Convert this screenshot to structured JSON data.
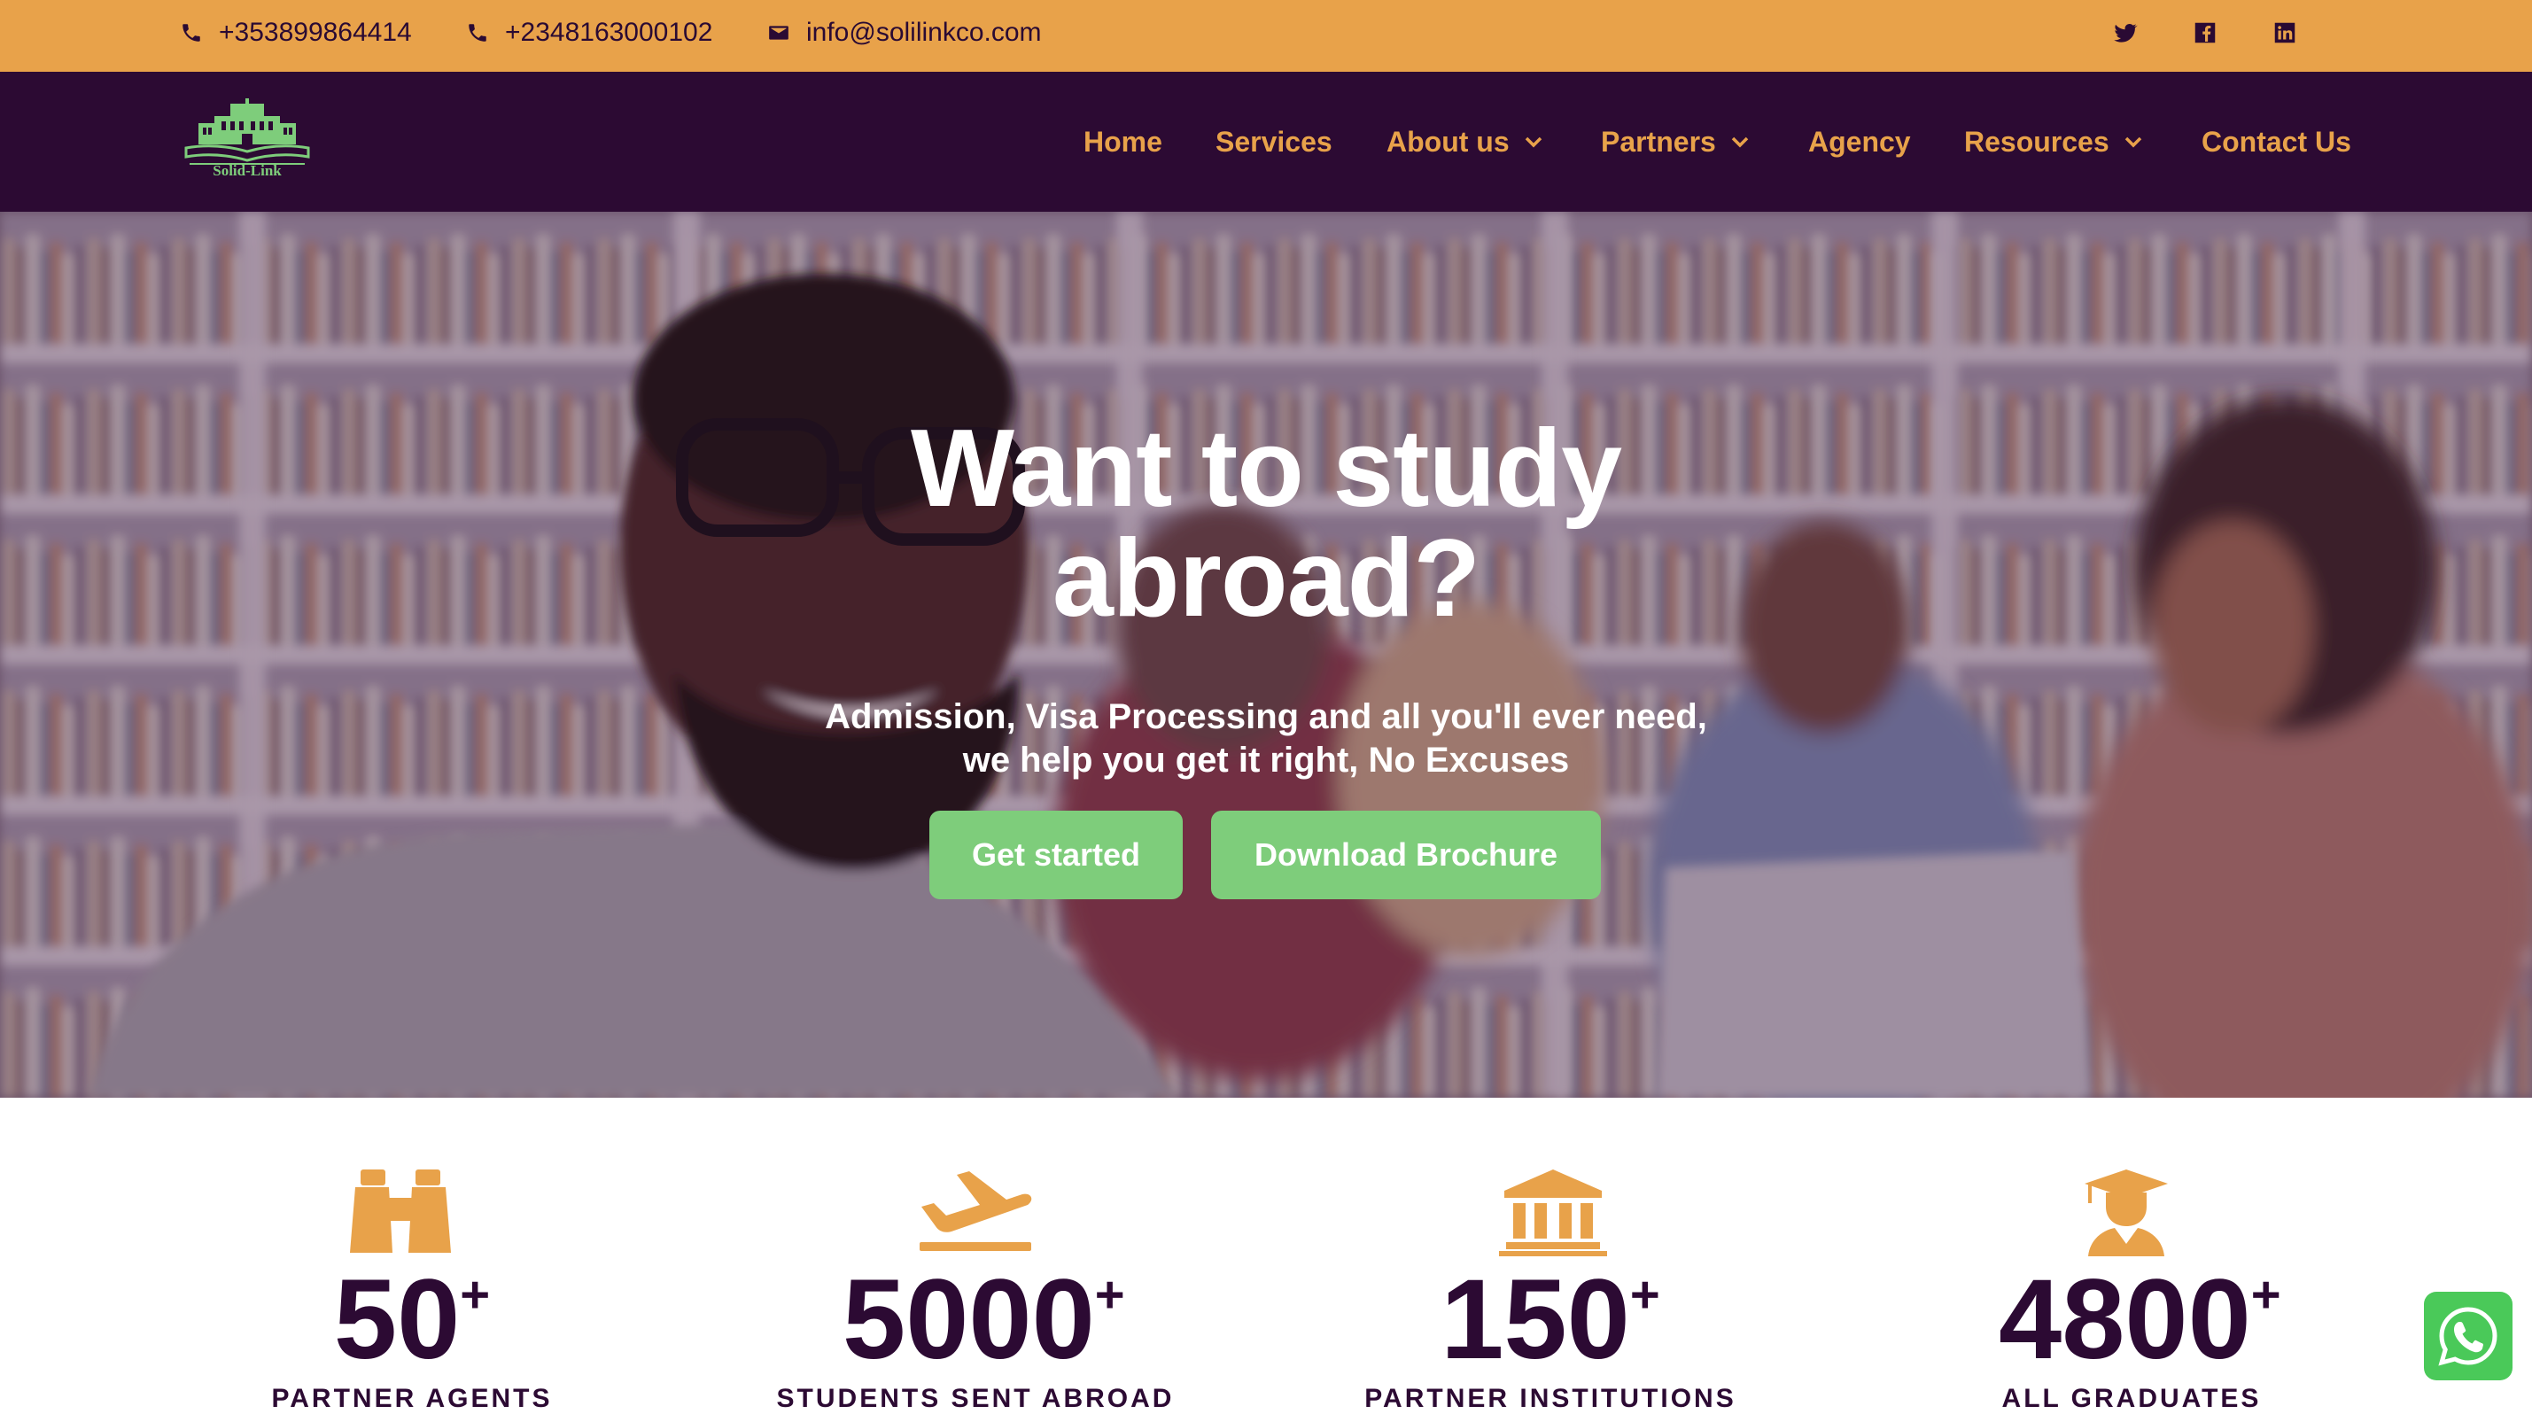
{
  "topbar": {
    "phone_1": "+353899864414",
    "phone_2": "+2348163000102",
    "email": "info@solilinkco.com",
    "icons": [
      "phone-icon",
      "phone-icon",
      "mail-icon",
      "twitter-icon",
      "facebook-icon",
      "linkedin-icon"
    ]
  },
  "brand": {
    "logo_text": "Solid-Link"
  },
  "nav": {
    "items": [
      {
        "label": "Home"
      },
      {
        "label": "Services"
      },
      {
        "label": "About us"
      },
      {
        "label": "Partners"
      },
      {
        "label": "Agency"
      },
      {
        "label": "Resources"
      },
      {
        "label": "Contact Us"
      }
    ]
  },
  "hero": {
    "title_line_1": "Want to study",
    "title_line_2": "abroad?",
    "subtitle_line_1": "Admission, Visa Processing and all you'll ever need,",
    "subtitle_line_2": "we help you get it right, No Excuses",
    "cta_primary": "Get started",
    "cta_secondary": "Download Brochure"
  },
  "stats": [
    {
      "value": "50",
      "suffix": "+",
      "label": "PARTNER AGENTS",
      "icon": "binoculars-icon"
    },
    {
      "value": "5000",
      "suffix": "+",
      "label": "STUDENTS SENT ABROAD",
      "icon": "airplane-icon"
    },
    {
      "value": "150",
      "suffix": "+",
      "label": "PARTNER INSTITUTIONS",
      "icon": "institution-icon"
    },
    {
      "value": "4800",
      "suffix": "+",
      "label": "ALL GRADUATES",
      "icon": "graduate-icon"
    }
  ],
  "colors": {
    "accent_orange": "#e8a24a",
    "brand_purple": "#2c0a33",
    "button_green": "#7ecd7b",
    "whatsapp_green": "#4ac959"
  }
}
